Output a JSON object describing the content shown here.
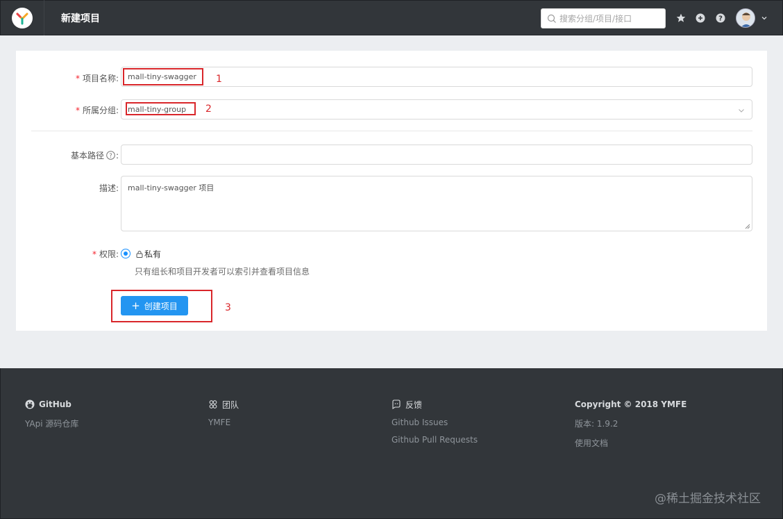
{
  "header": {
    "title": "新建项目",
    "search_placeholder": "搜索分组/项目/接口"
  },
  "form": {
    "project_name_label": "项目名称:",
    "project_name_value": "mall-tiny-swagger",
    "group_label": "所属分组:",
    "group_value": "mall-tiny-group",
    "base_path_label": "基本路径",
    "base_path_suffix": ":",
    "base_path_value": "",
    "desc_label": "描述:",
    "desc_value": "mall-tiny-swagger 项目",
    "permission_label": "权限:",
    "permission_option": "私有",
    "permission_hint": "只有组长和项目开发者可以索引并查看项目信息",
    "create_button": "创建项目",
    "required_mark": "*"
  },
  "annotations": [
    "1",
    "2",
    "3"
  ],
  "footer": {
    "columns": [
      {
        "title": "GitHub",
        "links": [
          "YApi 源码仓库"
        ]
      },
      {
        "title": "团队",
        "links": [
          "YMFE"
        ]
      },
      {
        "title": "反馈",
        "links": [
          "Github Issues",
          "Github Pull Requests"
        ]
      },
      {
        "title": "Copyright © 2018 YMFE",
        "links": [
          "版本: 1.9.2",
          "使用文档"
        ]
      }
    ]
  },
  "watermark": "@稀土掘金技术社区",
  "colors": {
    "header_bg": "#32363a",
    "primary": "#2395f1",
    "annotation_red": "#d9262a",
    "required": "#f5222d"
  }
}
